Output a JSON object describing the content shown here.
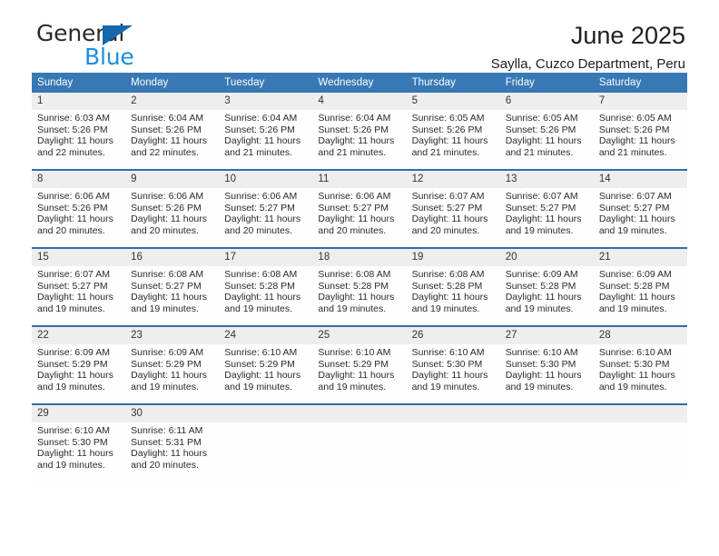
{
  "brand": {
    "line1": "General",
    "line2": "Blue",
    "triangle_color": "#1567b0",
    "line2_color": "#1b8ede"
  },
  "header": {
    "title": "June 2025",
    "subtitle": "Saylla, Cuzco Department, Peru"
  },
  "theme": {
    "header_blue": "#3878b4",
    "row_divider_blue": "#2f6ea8",
    "daynum_gray": "#eeeeee"
  },
  "weekday_headers": [
    "Sunday",
    "Monday",
    "Tuesday",
    "Wednesday",
    "Thursday",
    "Friday",
    "Saturday"
  ],
  "weeks": [
    [
      {
        "day": "1",
        "sunrise": "Sunrise: 6:03 AM",
        "sunset": "Sunset: 5:26 PM",
        "daylight": "Daylight: 11 hours and 22 minutes."
      },
      {
        "day": "2",
        "sunrise": "Sunrise: 6:04 AM",
        "sunset": "Sunset: 5:26 PM",
        "daylight": "Daylight: 11 hours and 22 minutes."
      },
      {
        "day": "3",
        "sunrise": "Sunrise: 6:04 AM",
        "sunset": "Sunset: 5:26 PM",
        "daylight": "Daylight: 11 hours and 21 minutes."
      },
      {
        "day": "4",
        "sunrise": "Sunrise: 6:04 AM",
        "sunset": "Sunset: 5:26 PM",
        "daylight": "Daylight: 11 hours and 21 minutes."
      },
      {
        "day": "5",
        "sunrise": "Sunrise: 6:05 AM",
        "sunset": "Sunset: 5:26 PM",
        "daylight": "Daylight: 11 hours and 21 minutes."
      },
      {
        "day": "6",
        "sunrise": "Sunrise: 6:05 AM",
        "sunset": "Sunset: 5:26 PM",
        "daylight": "Daylight: 11 hours and 21 minutes."
      },
      {
        "day": "7",
        "sunrise": "Sunrise: 6:05 AM",
        "sunset": "Sunset: 5:26 PM",
        "daylight": "Daylight: 11 hours and 21 minutes."
      }
    ],
    [
      {
        "day": "8",
        "sunrise": "Sunrise: 6:06 AM",
        "sunset": "Sunset: 5:26 PM",
        "daylight": "Daylight: 11 hours and 20 minutes."
      },
      {
        "day": "9",
        "sunrise": "Sunrise: 6:06 AM",
        "sunset": "Sunset: 5:26 PM",
        "daylight": "Daylight: 11 hours and 20 minutes."
      },
      {
        "day": "10",
        "sunrise": "Sunrise: 6:06 AM",
        "sunset": "Sunset: 5:27 PM",
        "daylight": "Daylight: 11 hours and 20 minutes."
      },
      {
        "day": "11",
        "sunrise": "Sunrise: 6:06 AM",
        "sunset": "Sunset: 5:27 PM",
        "daylight": "Daylight: 11 hours and 20 minutes."
      },
      {
        "day": "12",
        "sunrise": "Sunrise: 6:07 AM",
        "sunset": "Sunset: 5:27 PM",
        "daylight": "Daylight: 11 hours and 20 minutes."
      },
      {
        "day": "13",
        "sunrise": "Sunrise: 6:07 AM",
        "sunset": "Sunset: 5:27 PM",
        "daylight": "Daylight: 11 hours and 19 minutes."
      },
      {
        "day": "14",
        "sunrise": "Sunrise: 6:07 AM",
        "sunset": "Sunset: 5:27 PM",
        "daylight": "Daylight: 11 hours and 19 minutes."
      }
    ],
    [
      {
        "day": "15",
        "sunrise": "Sunrise: 6:07 AM",
        "sunset": "Sunset: 5:27 PM",
        "daylight": "Daylight: 11 hours and 19 minutes."
      },
      {
        "day": "16",
        "sunrise": "Sunrise: 6:08 AM",
        "sunset": "Sunset: 5:27 PM",
        "daylight": "Daylight: 11 hours and 19 minutes."
      },
      {
        "day": "17",
        "sunrise": "Sunrise: 6:08 AM",
        "sunset": "Sunset: 5:28 PM",
        "daylight": "Daylight: 11 hours and 19 minutes."
      },
      {
        "day": "18",
        "sunrise": "Sunrise: 6:08 AM",
        "sunset": "Sunset: 5:28 PM",
        "daylight": "Daylight: 11 hours and 19 minutes."
      },
      {
        "day": "19",
        "sunrise": "Sunrise: 6:08 AM",
        "sunset": "Sunset: 5:28 PM",
        "daylight": "Daylight: 11 hours and 19 minutes."
      },
      {
        "day": "20",
        "sunrise": "Sunrise: 6:09 AM",
        "sunset": "Sunset: 5:28 PM",
        "daylight": "Daylight: 11 hours and 19 minutes."
      },
      {
        "day": "21",
        "sunrise": "Sunrise: 6:09 AM",
        "sunset": "Sunset: 5:28 PM",
        "daylight": "Daylight: 11 hours and 19 minutes."
      }
    ],
    [
      {
        "day": "22",
        "sunrise": "Sunrise: 6:09 AM",
        "sunset": "Sunset: 5:29 PM",
        "daylight": "Daylight: 11 hours and 19 minutes."
      },
      {
        "day": "23",
        "sunrise": "Sunrise: 6:09 AM",
        "sunset": "Sunset: 5:29 PM",
        "daylight": "Daylight: 11 hours and 19 minutes."
      },
      {
        "day": "24",
        "sunrise": "Sunrise: 6:10 AM",
        "sunset": "Sunset: 5:29 PM",
        "daylight": "Daylight: 11 hours and 19 minutes."
      },
      {
        "day": "25",
        "sunrise": "Sunrise: 6:10 AM",
        "sunset": "Sunset: 5:29 PM",
        "daylight": "Daylight: 11 hours and 19 minutes."
      },
      {
        "day": "26",
        "sunrise": "Sunrise: 6:10 AM",
        "sunset": "Sunset: 5:30 PM",
        "daylight": "Daylight: 11 hours and 19 minutes."
      },
      {
        "day": "27",
        "sunrise": "Sunrise: 6:10 AM",
        "sunset": "Sunset: 5:30 PM",
        "daylight": "Daylight: 11 hours and 19 minutes."
      },
      {
        "day": "28",
        "sunrise": "Sunrise: 6:10 AM",
        "sunset": "Sunset: 5:30 PM",
        "daylight": "Daylight: 11 hours and 19 minutes."
      }
    ],
    [
      {
        "day": "29",
        "sunrise": "Sunrise: 6:10 AM",
        "sunset": "Sunset: 5:30 PM",
        "daylight": "Daylight: 11 hours and 19 minutes."
      },
      {
        "day": "30",
        "sunrise": "Sunrise: 6:11 AM",
        "sunset": "Sunset: 5:31 PM",
        "daylight": "Daylight: 11 hours and 20 minutes."
      },
      {
        "day": "",
        "sunrise": "",
        "sunset": "",
        "daylight": ""
      },
      {
        "day": "",
        "sunrise": "",
        "sunset": "",
        "daylight": ""
      },
      {
        "day": "",
        "sunrise": "",
        "sunset": "",
        "daylight": ""
      },
      {
        "day": "",
        "sunrise": "",
        "sunset": "",
        "daylight": ""
      },
      {
        "day": "",
        "sunrise": "",
        "sunset": "",
        "daylight": ""
      }
    ]
  ]
}
